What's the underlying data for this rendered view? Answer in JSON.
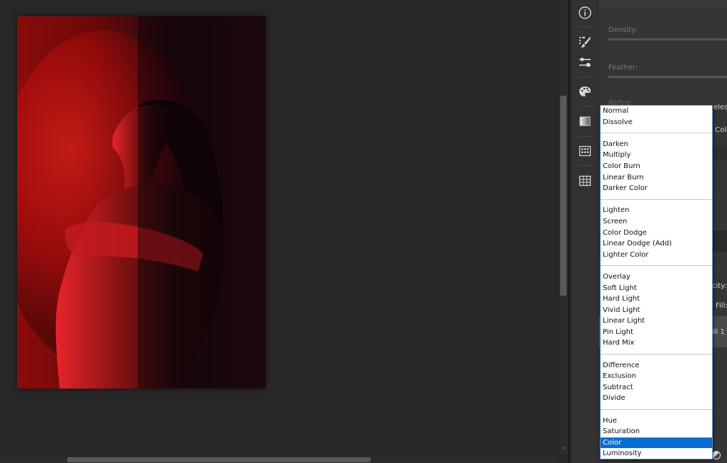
{
  "panel": {
    "density_label": "Density:",
    "feather_label": "Feather:",
    "refine_label": "Refine:",
    "frag_select": "electi",
    "frag_color": "Colo",
    "frag_opacity": "city:",
    "frag_fill": "Fill:",
    "frag_fill_layer": "ill 1"
  },
  "toolbar": {
    "icons": [
      "info-icon",
      "brush-presets-icon",
      "adjustments-icon",
      "palette-icon",
      "gradient-icon",
      "patterns-icon",
      "table-grid-icon"
    ]
  },
  "blend_menu": {
    "selected": "Color",
    "groups": [
      [
        "Normal",
        "Dissolve"
      ],
      [
        "Darken",
        "Multiply",
        "Color Burn",
        "Linear Burn",
        "Darker Color"
      ],
      [
        "Lighten",
        "Screen",
        "Color Dodge",
        "Linear Dodge (Add)",
        "Lighter Color"
      ],
      [
        "Overlay",
        "Soft Light",
        "Hard Light",
        "Vivid Light",
        "Linear Light",
        "Pin Light",
        "Hard Mix"
      ],
      [
        "Difference",
        "Exclusion",
        "Subtract",
        "Divide"
      ],
      [
        "Hue",
        "Saturation",
        "Color",
        "Luminosity"
      ]
    ]
  },
  "colors": {
    "selection": "#0a6ed1",
    "canvas_bg": "#282828",
    "panel_bg": "#353535"
  }
}
